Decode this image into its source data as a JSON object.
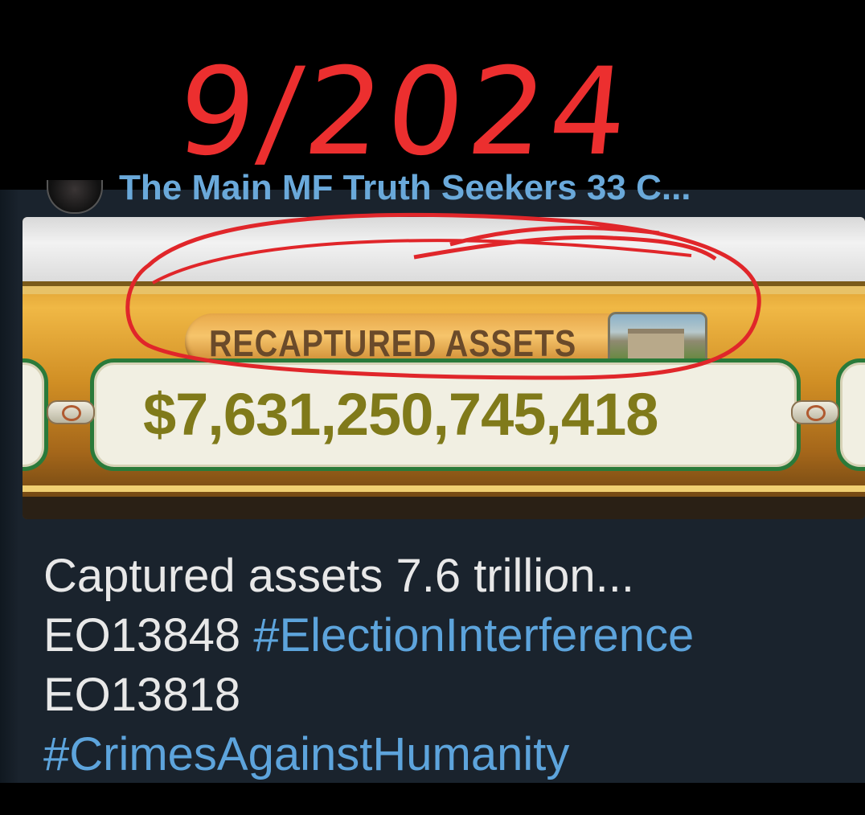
{
  "annotation": {
    "date": "9/2024"
  },
  "post": {
    "channel_name": "The Main MF Truth Seekers 33 C...",
    "banner": {
      "label": "RECAPTURED ASSETS",
      "value": "$7,631,250,745,418",
      "castle_icon": "castle-icon"
    },
    "message": {
      "line1": "Captured assets 7.6 trillion...",
      "line2_prefix": "EO13848 ",
      "line2_hashtag": "#ElectionInterference",
      "line3": "EO13818",
      "line4_hashtag": "#CrimesAgainstHumanity"
    }
  },
  "colors": {
    "annotation_red": "#ec2f2f",
    "hashtag_blue": "#5da4dc",
    "card_bg": "#1a232d",
    "value_text": "#807a1a"
  }
}
